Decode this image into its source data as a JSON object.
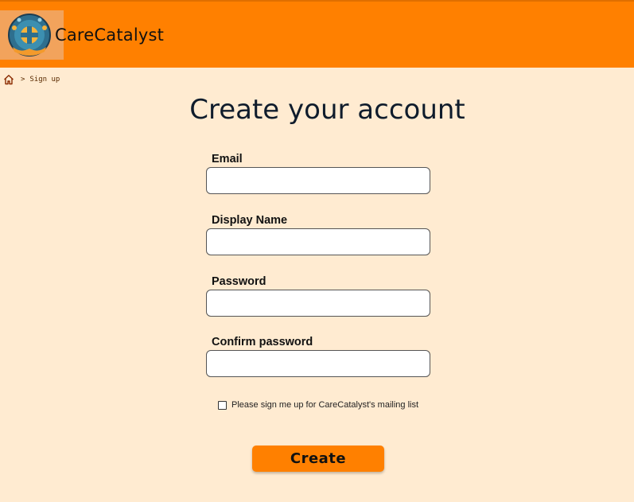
{
  "header": {
    "brand": "CareCatalyst"
  },
  "breadcrumb": {
    "home_icon": "home-icon",
    "separator": ">",
    "current": "Sign up"
  },
  "page": {
    "title": "Create your account"
  },
  "form": {
    "email_label": "Email",
    "email_value": "",
    "display_name_label": "Display Name",
    "display_name_value": "",
    "password_label": "Password",
    "password_value": "",
    "confirm_label": "Confirm password",
    "confirm_value": "",
    "mailing_label": "Please sign me up for CareCatalyst's mailing list",
    "mailing_checked": false,
    "submit_label": "Create"
  },
  "colors": {
    "header_bg": "#FF8000",
    "page_bg": "#FFEBD1",
    "button_bg": "#FF8000"
  }
}
